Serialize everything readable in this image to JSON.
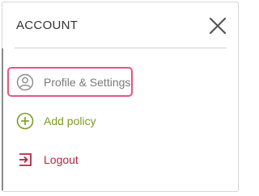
{
  "header": {
    "title": "ACCOUNT",
    "close_icon": "close-icon"
  },
  "menu": {
    "items": [
      {
        "label": "Profile & Settings",
        "icon": "user-circle-icon",
        "color": "#7a7a7a",
        "focused": true
      },
      {
        "label": "Add policy",
        "icon": "plus-circle-icon",
        "color": "#7d9b26"
      },
      {
        "label": "Logout",
        "icon": "logout-icon",
        "color": "#c0213e"
      }
    ]
  },
  "colors": {
    "focus_ring": "#e8557f",
    "accent_green": "#7d9b26",
    "accent_red": "#c0213e"
  }
}
